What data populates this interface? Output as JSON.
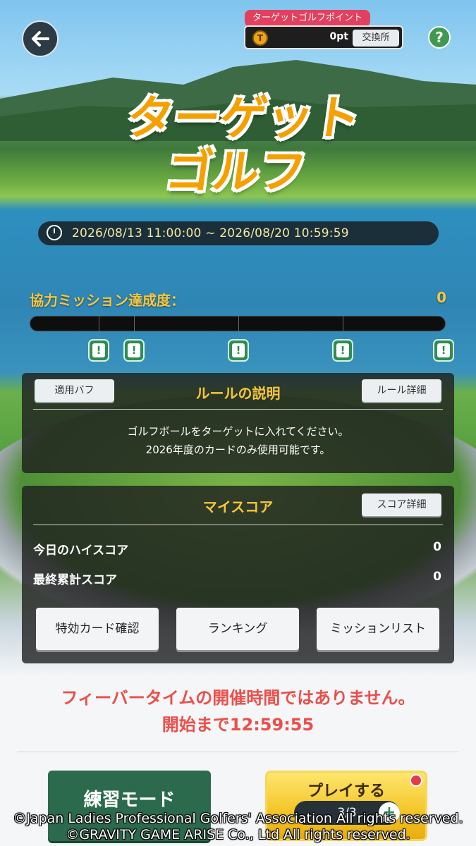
{
  "header": {
    "points_label": "ターゲットゴルフポイント",
    "points_value": "0pt",
    "exchange_label": "交換所",
    "help_label": "?"
  },
  "title": {
    "line1": "ターゲット",
    "line2": "ゴルフ"
  },
  "event_period": "2026/08/13 11:00:00 ~ 2026/08/20 10:59:59",
  "mission": {
    "label": "協力ミッション達成度：",
    "value": "0",
    "progress_fraction": 0,
    "marker_symbol": "!"
  },
  "rules": {
    "buff_button": "適用バフ",
    "title": "ルールの説明",
    "detail_button": "ルール詳細",
    "line1": "ゴルフボールをターゲットに入れてください。",
    "line2": "2026年度のカードのみ使用可能です。"
  },
  "my_score": {
    "title": "マイスコア",
    "detail_button": "スコア詳細",
    "today_label": "今日のハイスコア",
    "today_value": "0",
    "total_label": "最終累計スコア",
    "total_value": "0",
    "buttons": [
      "特効カード確認",
      "ランキング",
      "ミッションリスト"
    ]
  },
  "fever": {
    "line1": "フィーバータイムの開催時間ではありません。",
    "line2": "開始まで12:59:55"
  },
  "actions": {
    "practice": "練習モード",
    "play": "プレイする",
    "play_count": "3/3",
    "plus": "+"
  },
  "copyright": {
    "line1": "©Japan Ladies Professional Golfers' Association All rights reserved.",
    "line2": "©GRAVITY GAME ARISE Co., Ltd All rights reserved."
  },
  "colors": {
    "accent_yellow": "#f6c63e",
    "fever_red": "#ea4f4a",
    "practice_green": "#2c6a4e"
  }
}
